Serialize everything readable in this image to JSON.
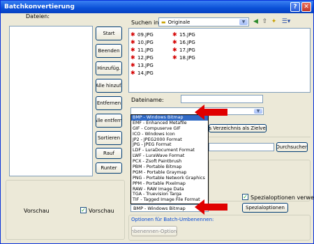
{
  "window": {
    "title": "Batchkonvertierung",
    "help": "?",
    "close": "✕"
  },
  "files": {
    "label": "Dateien:"
  },
  "buttons": {
    "start": "Start",
    "beenden": "Beenden",
    "hinzufug": "Hinzufüg.",
    "alle_hinzu": "Alle hinzuf.",
    "entfernen": "Entfernen",
    "alle_entfernen": "Alle entfern.",
    "sortieren": "Sortieren",
    "rauf": "Rauf",
    "runter": "Runter"
  },
  "search": {
    "label": "Suchen in:",
    "folder": "Originale"
  },
  "file_list": [
    "09.JPG",
    "10.JPG",
    "11.JPG",
    "12.JPG",
    "13.JPG",
    "14.JPG",
    "15.JPG",
    "16.JPG",
    "17.JPG",
    "18.JPG"
  ],
  "filename": {
    "label": "Dateiname:",
    "value": ""
  },
  "target_folder_button": "ses Verzeichnis als Zielverz.",
  "browse_button": "Durchsuchen",
  "format_options": [
    "BMP - Windows Bitmap",
    "EMF - Enhanced Metafile",
    "GIF - Compuserve GIF",
    "ICO - Windows Icon",
    "JP2 - JPEG2000 Format",
    "JPG - JPEG Format",
    "LDF - LuraDocument Format",
    "LWF - LuraWave Format",
    "PCX - Zsoft Paintbrush",
    "PBM - Portable Bitmap",
    "PGM - Portable Graymap",
    "PNG - Portable Network Graphics",
    "PPM - Portable Pixelmap",
    "RAW - RAW Image Data",
    "TGA - Truevision Targa",
    "TIF - Tagged Image File Format"
  ],
  "format_selected": "BMP - Windows Bitmap",
  "preview": {
    "label": "Vorschau",
    "checkbox_label": "Vorschau",
    "checked": true
  },
  "special": {
    "checkbox_label": "Spezialoptionen verwenden",
    "checked": true,
    "button": "Spezialoptionen"
  },
  "rename": {
    "group_label": "Optionen für Batch-Umbenennen:",
    "button": "Umbenennen-Optionen"
  },
  "colors": {
    "arrow": "#e00000",
    "selection": "#316ac5",
    "titlebar": "#0a4fd6"
  }
}
